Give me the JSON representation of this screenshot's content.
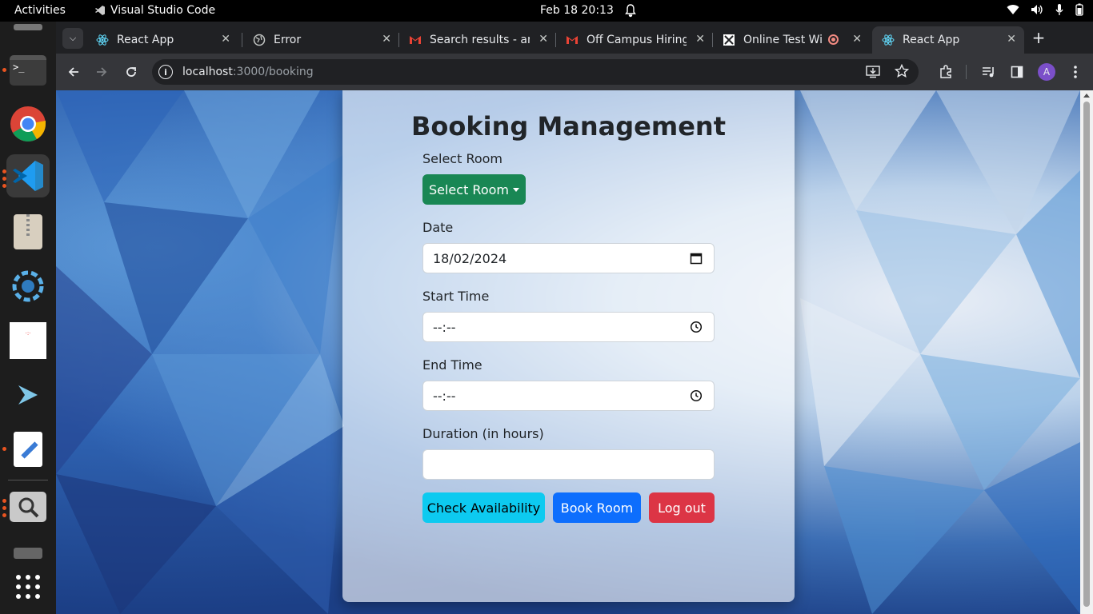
{
  "topbar": {
    "activities": "Activities",
    "app_name": "Visual Studio Code",
    "clock": "Feb 18  20:13"
  },
  "tabs": [
    {
      "title": "React App",
      "icon": "react-icon"
    },
    {
      "title": "Error",
      "icon": "globe-icon"
    },
    {
      "title": "Search results - am",
      "icon": "gmail-icon"
    },
    {
      "title": "Off Campus Hiring",
      "icon": "gmail-icon"
    },
    {
      "title": "Online Test Wi",
      "icon": "test-site-icon"
    },
    {
      "title": "React App",
      "icon": "react-icon"
    }
  ],
  "address": {
    "host": "localhost",
    "path": ":3000/booking"
  },
  "profile_initial": "A",
  "form": {
    "title": "Booking Management",
    "room_label": "Select Room",
    "room_button": "Select Room",
    "date_label": "Date",
    "date_value": "18/02/2024",
    "start_label": "Start Time",
    "start_value": "--:--",
    "end_label": "End Time",
    "end_value": "--:--",
    "duration_label": "Duration (in hours)",
    "duration_value": "",
    "check_button": "Check Availability",
    "book_button": "Book Room",
    "logout_button": "Log out"
  },
  "colors": {
    "success": "#198754",
    "info": "#0dcaf0",
    "primary": "#0d6efd",
    "danger": "#dc3545"
  }
}
